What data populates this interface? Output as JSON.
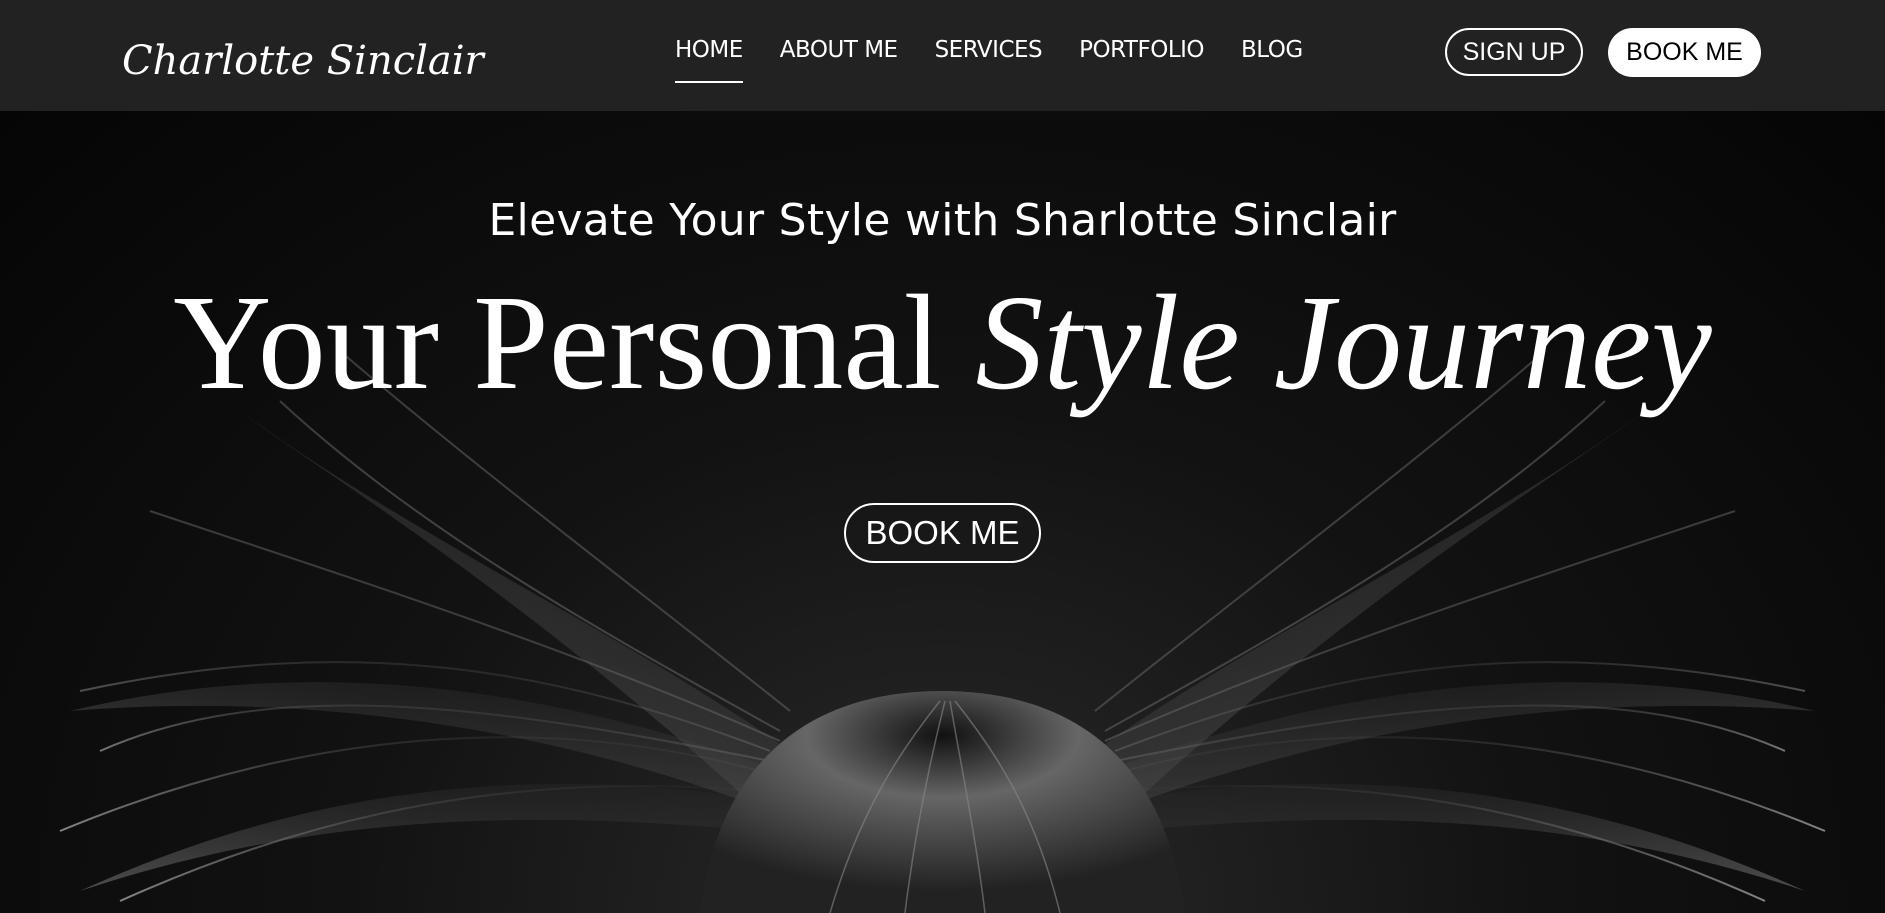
{
  "header": {
    "logo_text": "Charlotte Sinclair",
    "nav": [
      {
        "label": "HOME",
        "active": true
      },
      {
        "label": "ABOUT ME"
      },
      {
        "label": "SERVICES"
      },
      {
        "label": "PORTFOLIO"
      },
      {
        "label": "BLOG"
      }
    ],
    "signup_label": "SIGN UP",
    "book_label": "BOOK ME"
  },
  "hero": {
    "subtitle": "Elevate Your Style with Sharlotte Sinclair",
    "title_plain": "Your Personal ",
    "title_italic": "Style Journey",
    "cta_label": "BOOK ME",
    "image_description_icon": "flowing-hair-photo"
  },
  "colors": {
    "header_bg": "#222222",
    "hero_bg": "#000000",
    "text": "#ffffff"
  }
}
